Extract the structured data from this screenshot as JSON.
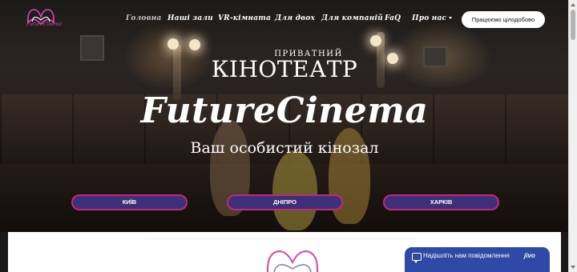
{
  "nav": {
    "items": [
      {
        "label": "Головна"
      },
      {
        "label": "Наші зали"
      },
      {
        "label": "VR-кімната"
      },
      {
        "label": "Для двох"
      },
      {
        "label": "Для компаній"
      },
      {
        "label": "FaQ"
      },
      {
        "label": "Про нас"
      }
    ],
    "cta_label": "Працюємо цілодобово"
  },
  "logo": {
    "text": "FutureCinema"
  },
  "hero": {
    "overline": "ПРИВАТНИЙ",
    "headline": "КІНОТЕАТР",
    "brand": "FutureCinema",
    "tagline": "Ваш особистий кінозал"
  },
  "cities": [
    {
      "label": "КИЇВ"
    },
    {
      "label": "ДНІПРО"
    },
    {
      "label": "ХАРКІВ"
    }
  ],
  "chat": {
    "label": "Надішліть нам повідомлення",
    "brand": "jivo"
  },
  "colors": {
    "button_fill": "#3d2f7a",
    "button_border": "#c12b72",
    "chat": "#2f4aa6",
    "logo": "#d84ab0"
  }
}
